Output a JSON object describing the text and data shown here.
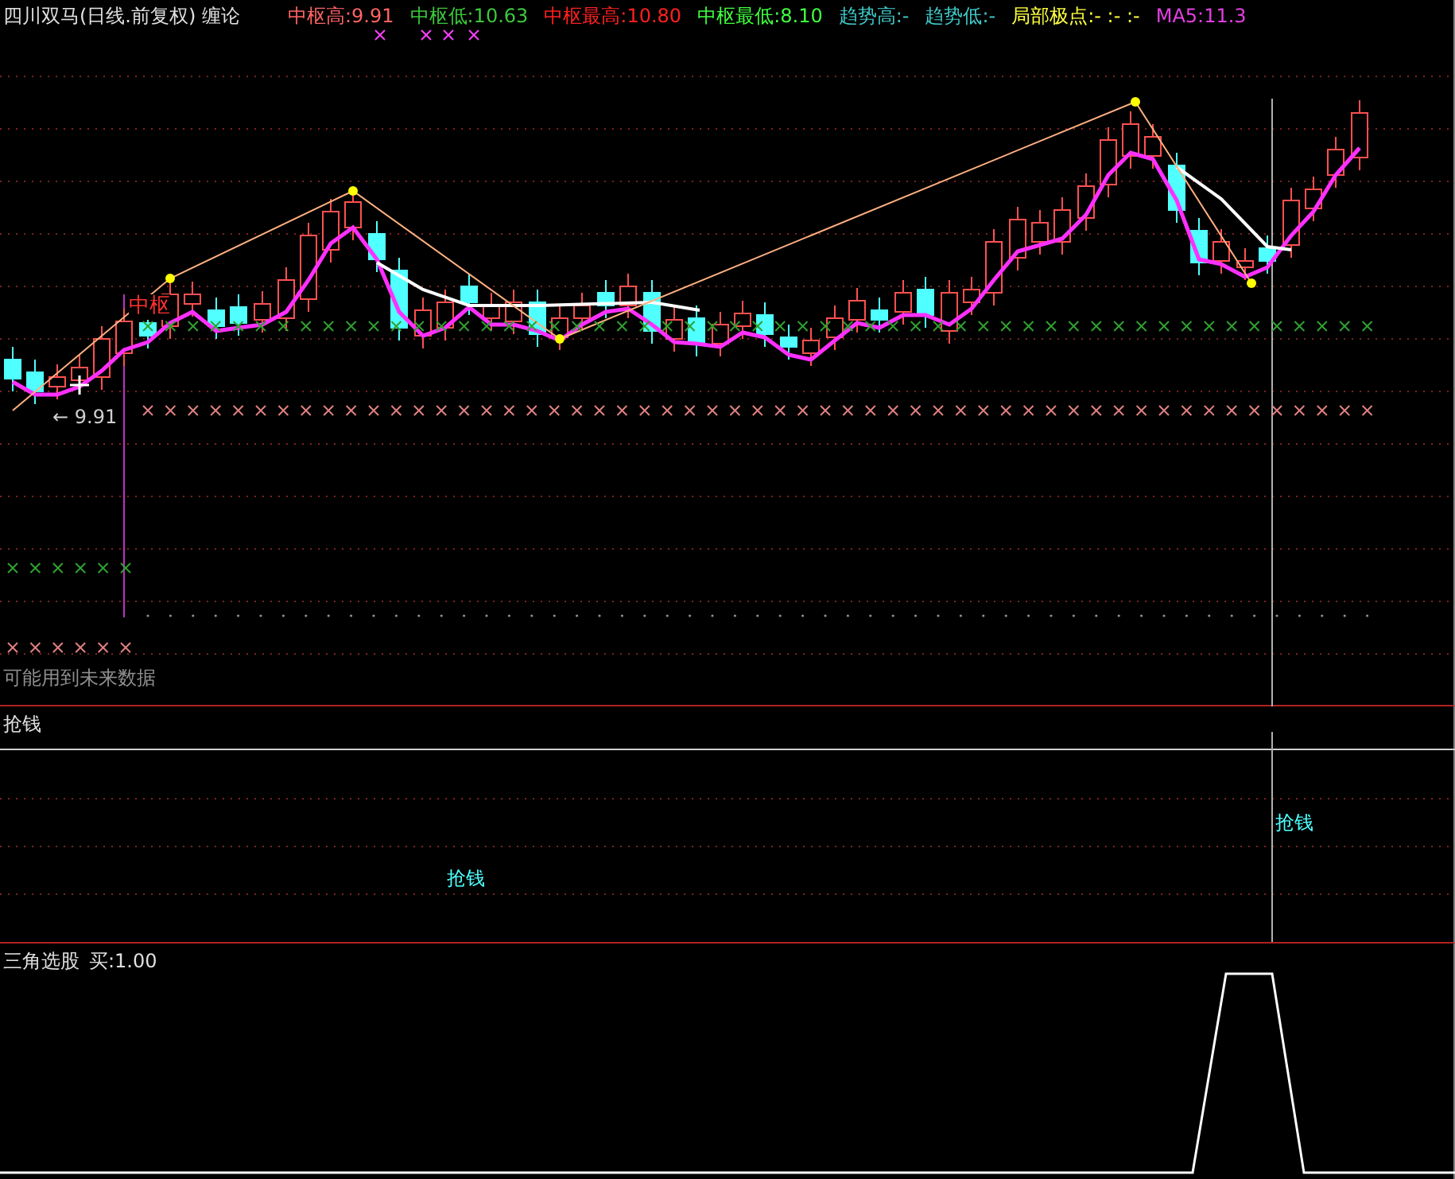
{
  "title": "四川双马(日线.前复权) 缠论",
  "indicators": [
    {
      "text": "中枢高:9.91",
      "color": "#ff6464"
    },
    {
      "text": "中枢低:10.63",
      "color": "#3cc83c"
    },
    {
      "text": "中枢最高:10.80",
      "color": "#ff2020"
    },
    {
      "text": "中枢最低:8.10",
      "color": "#40ff40"
    },
    {
      "text": "趋势高:-",
      "color": "#40c8c8"
    },
    {
      "text": "趋势低:-",
      "color": "#40c8c8"
    },
    {
      "text": "局部极点:- :- :-",
      "color": "#ffff40"
    },
    {
      "text": "MA5:11.3",
      "color": "#e040e0"
    }
  ],
  "main_chart": {
    "zhongshu_label": "中枢",
    "price_marker": "← 9.91",
    "warning": "可能用到未来数据"
  },
  "panel_2": {
    "title": "抢钱",
    "signals": [
      "抢钱",
      "抢钱"
    ]
  },
  "panel_3": {
    "title": "三角选股",
    "reading": "买:1.00"
  }
}
